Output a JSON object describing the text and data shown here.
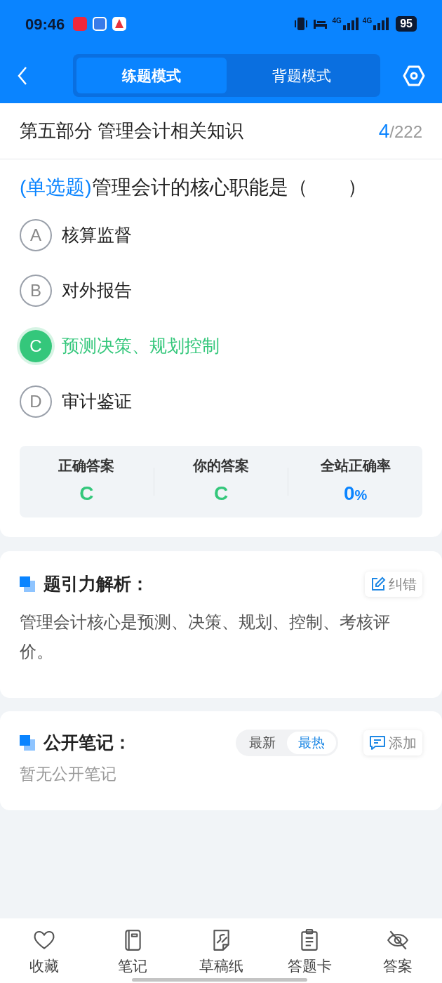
{
  "status_bar": {
    "time": "09:46",
    "network_labels": [
      "4G",
      "4G"
    ],
    "battery": "95"
  },
  "header": {
    "tabs": [
      {
        "label": "练题模式",
        "selected": true
      },
      {
        "label": "背题模式",
        "selected": false
      }
    ]
  },
  "section": {
    "title": "第五部分 管理会计相关知识",
    "current": "4",
    "total": "/222"
  },
  "question": {
    "type_label": "(单选题)",
    "text": "管理会计的核心职能是（　　）"
  },
  "options": [
    {
      "letter": "A",
      "text": "核算监督",
      "selected": false
    },
    {
      "letter": "B",
      "text": "对外报告",
      "selected": false
    },
    {
      "letter": "C",
      "text": "预测决策、规划控制",
      "selected": true
    },
    {
      "letter": "D",
      "text": "审计鉴证",
      "selected": false
    }
  ],
  "stats": [
    {
      "kind": "answer",
      "label": "正确答案",
      "value": "C"
    },
    {
      "kind": "answer",
      "label": "你的答案",
      "value": "C"
    },
    {
      "kind": "rate",
      "label": "全站正确率",
      "value": "0",
      "unit": "%"
    }
  ],
  "analysis": {
    "title": "题引力解析：",
    "button": "纠错",
    "text": "管理会计核心是预测、决策、规划、控制、考核评价。"
  },
  "notes": {
    "title": "公开笔记：",
    "sort_tabs": [
      {
        "label": "最新",
        "selected": false
      },
      {
        "label": "最热",
        "selected": true
      }
    ],
    "add_button": "添加",
    "empty_text": "暂无公开笔记"
  },
  "bottom_nav": [
    {
      "label": "收藏"
    },
    {
      "label": "笔记"
    },
    {
      "label": "草稿纸"
    },
    {
      "label": "答题卡"
    },
    {
      "label": "答案"
    }
  ]
}
